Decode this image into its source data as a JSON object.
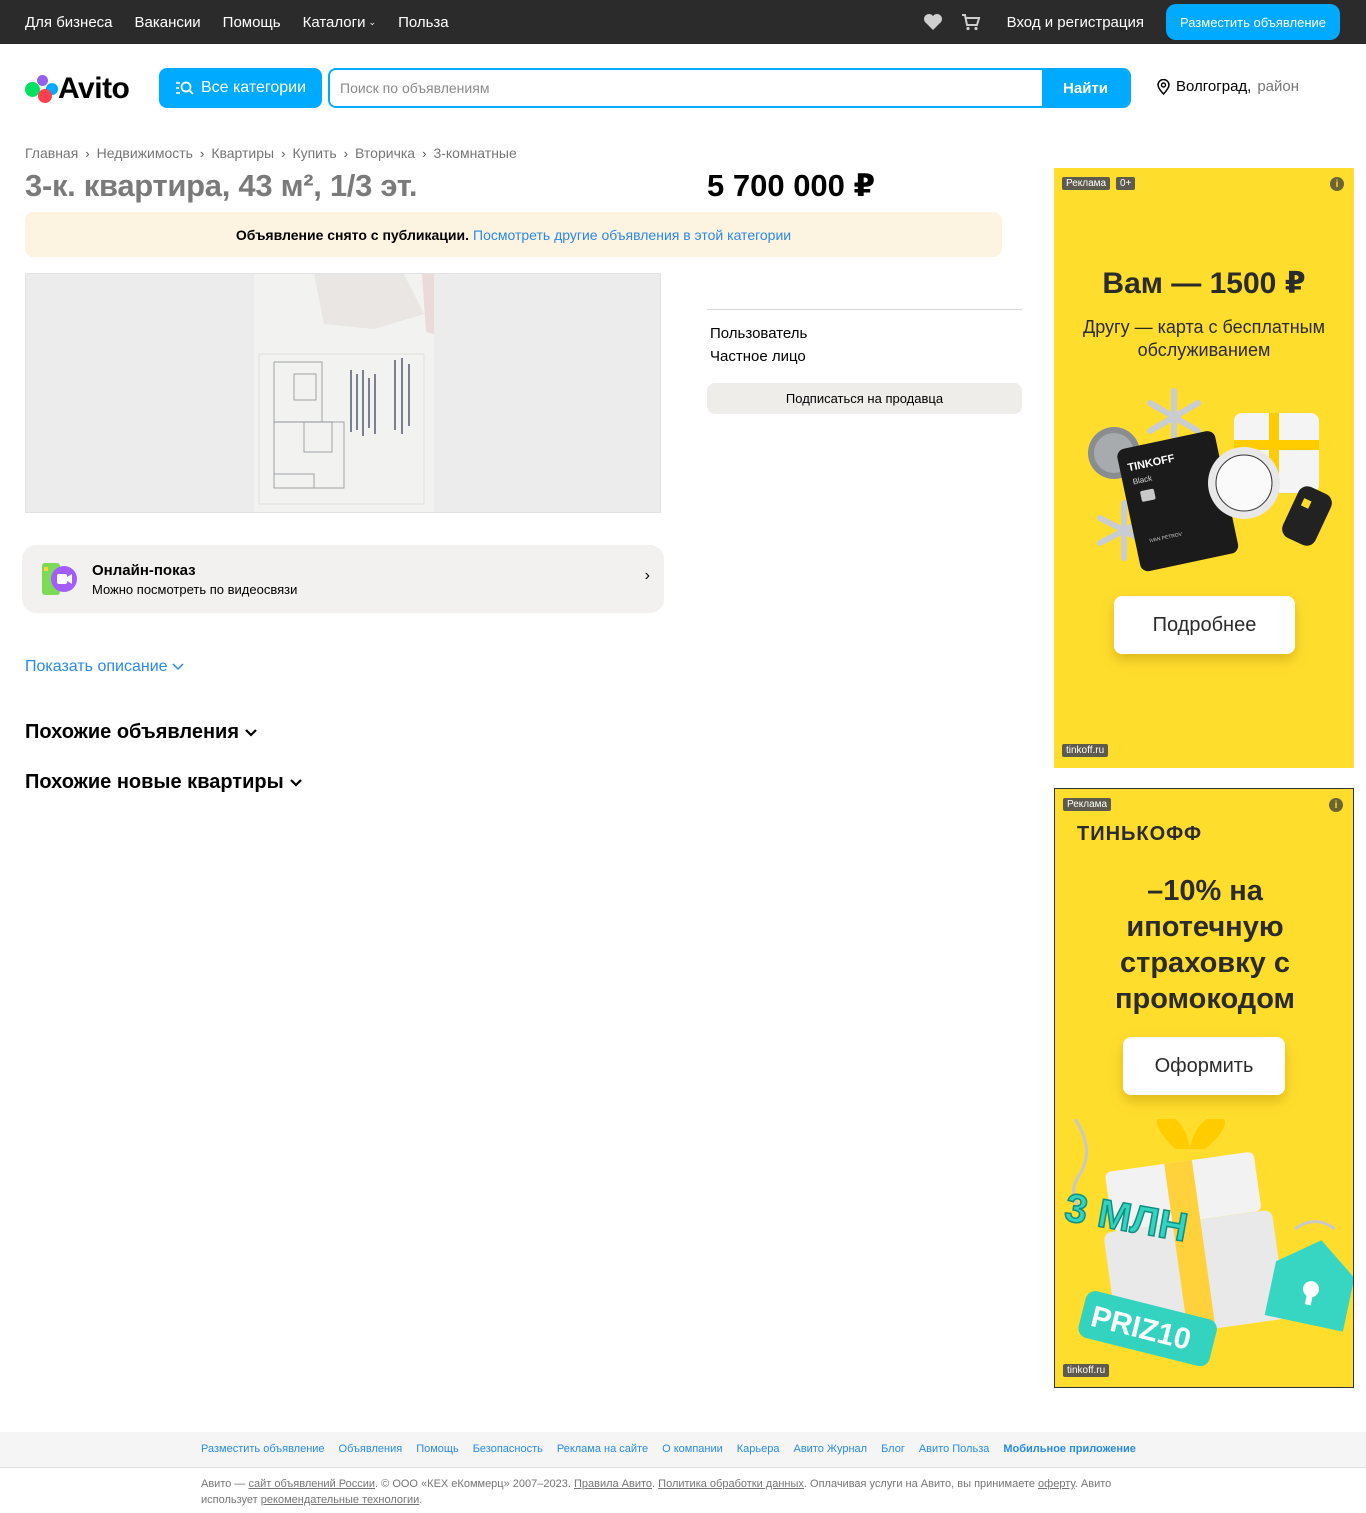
{
  "topbar": {
    "nav": [
      "Для бизнеса",
      "Вакансии",
      "Помощь",
      "Каталоги",
      "Польза"
    ],
    "login": "Вход и регистрация",
    "post_ad": "Разместить объявление"
  },
  "header": {
    "logo_text": "Avito",
    "categories_button": "Все категории",
    "search_placeholder": "Поиск по объявлениям",
    "search_button": "Найти",
    "city": "Волгоград,",
    "region": "район"
  },
  "breadcrumbs": [
    "Главная",
    "Недвижимость",
    "Квартиры",
    "Купить",
    "Вторичка",
    "3-комнатные"
  ],
  "listing": {
    "title": "3-к. квартира, 43 м², 1/3 эт.",
    "price": "5 700 000 ₽",
    "notice_bold": "Объявление снято с публикации.",
    "notice_link": "Посмотреть другие объявления в этой категории"
  },
  "seller": {
    "name": "Пользователь",
    "type": "Частное лицо",
    "subscribe": "Подписаться на продавца"
  },
  "online_show": {
    "title": "Онлайн-показ",
    "subtitle": "Можно посмотреть по видеосвязи"
  },
  "show_description": "Показать описание",
  "similar_ads": "Похожие объявления",
  "similar_new": "Похожие новые квартиры",
  "ads": {
    "ad1": {
      "label": "Реклама",
      "age": "0+",
      "headline": "Вам — 1500 ₽",
      "sub": "Другу — карта с бесплатным обслуживанием",
      "card_brand": "TINKOFF",
      "card_tier": "Black",
      "card_holder": "IVAN PETROV",
      "button": "Подробнее",
      "domain": "tinkoff.ru"
    },
    "ad2": {
      "label": "Реклама",
      "brand": "ТИНЬКОФФ",
      "headline": "–10% на ипотечную страховку с промокодом",
      "button": "Оформить",
      "promo_big": "3 МЛН",
      "promo_code": "PRIZ10",
      "domain": "tinkoff.ru"
    }
  },
  "footer": {
    "links": [
      "Разместить объявление",
      "Объявления",
      "Помощь",
      "Безопасность",
      "Реклама на сайте",
      "О компании",
      "Карьера",
      "Авито Журнал",
      "Блог",
      "Авито Польза",
      "Мобильное приложение"
    ],
    "c1": "Авито — ",
    "c2": "сайт объявлений России",
    "c3": ". © ООО «КЕХ еКоммерц» 2007–2023. ",
    "c4": "Правила Авито",
    "c5": ". ",
    "c6": "Политика обработки данных",
    "c7": ". Оплачивая услуги на Авито, вы принимаете ",
    "c8": "оферту",
    "c9": ". Авито использует ",
    "c10": "рекомендательные технологии",
    "c11": "."
  },
  "colors": {
    "accent": "#00aaff",
    "link": "#2a8ae6",
    "ad_yellow": "#ffdd2d",
    "notice_bg": "#fdf3e1"
  }
}
